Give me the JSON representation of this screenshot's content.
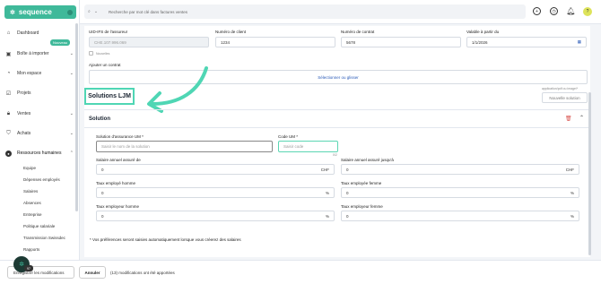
{
  "app": {
    "name": "sequence"
  },
  "colors": {
    "brand": "#3fb99a",
    "highlight": "#4fd6b4",
    "danger": "#d9534f"
  },
  "sidebar": {
    "items": [
      {
        "label": "Dashboard",
        "icon": "dashboard-icon"
      },
      {
        "label": "Boîte à importer",
        "icon": "inbox-icon",
        "badge": "Nouveau"
      },
      {
        "label": "Mon espace",
        "icon": "user-icon"
      },
      {
        "label": "Projets",
        "icon": "check-icon"
      },
      {
        "label": "Ventes",
        "icon": "lock-icon"
      },
      {
        "label": "Achats",
        "icon": "cart-icon"
      },
      {
        "label": "Ressources humaines",
        "icon": "person-icon"
      }
    ],
    "sub_items": [
      "Equipe",
      "Dépenses employés",
      "Salaires",
      "Absences",
      "Entreprise",
      "Politique salariale",
      "Transmission Swissdec",
      "Rapports"
    ]
  },
  "topbar": {
    "search_placeholder": "Recherche par mot clé dans factures ventes"
  },
  "form": {
    "uid_label": "UID-IFS de l'assureur",
    "uid_value": "CHE.107.996.069",
    "uid_hint": "Nouvelles",
    "client_label": "Numéro de client",
    "client_value": "1234",
    "contract_label": "Numéro de contrat",
    "contract_value": "5678",
    "valid_label": "Valable à partir du",
    "valid_value": "1/1/2026",
    "add_contract_label": "Ajouter un contrat",
    "add_contract_button": "Sélectionner ou glisser",
    "file_hint": "application/pdf ou image/*",
    "new_solution_button": "Nouvelle solution"
  },
  "solutions": {
    "title": "Solutions LJM",
    "section_title": "Solution",
    "solution_label": "Solution d'assurance UM *",
    "solution_placeholder": "Saisir le nom de la solution",
    "code_label": "Code UM *",
    "code_placeholder": "Saisir code",
    "code_counter": "0/2",
    "salary_min_label": "Salaire annuel assuré de",
    "salary_min_value": "0",
    "salary_max_label": "Salaire annuel assuré jusqu'à",
    "salary_max_value": "0",
    "currency": "CHF",
    "rate_emp_male_label": "Taux employé homme",
    "rate_emp_male_value": "0",
    "rate_emp_female_label": "Taux employée femme",
    "rate_emp_female_value": "0",
    "rate_er_male_label": "Taux employeur homme",
    "rate_er_male_value": "0",
    "rate_er_female_label": "Taux employeur femme",
    "rate_er_female_value": "0",
    "percent": "%",
    "note": "* Vos préférences seront saisies automatiquement lorsque vous créerez des salaires"
  },
  "bottombar": {
    "save_label": "Enregistrer les modifications",
    "cancel_label": "Annuler",
    "changes_note": "(13) modifications ont été apportées",
    "avatar_badge": "97"
  }
}
